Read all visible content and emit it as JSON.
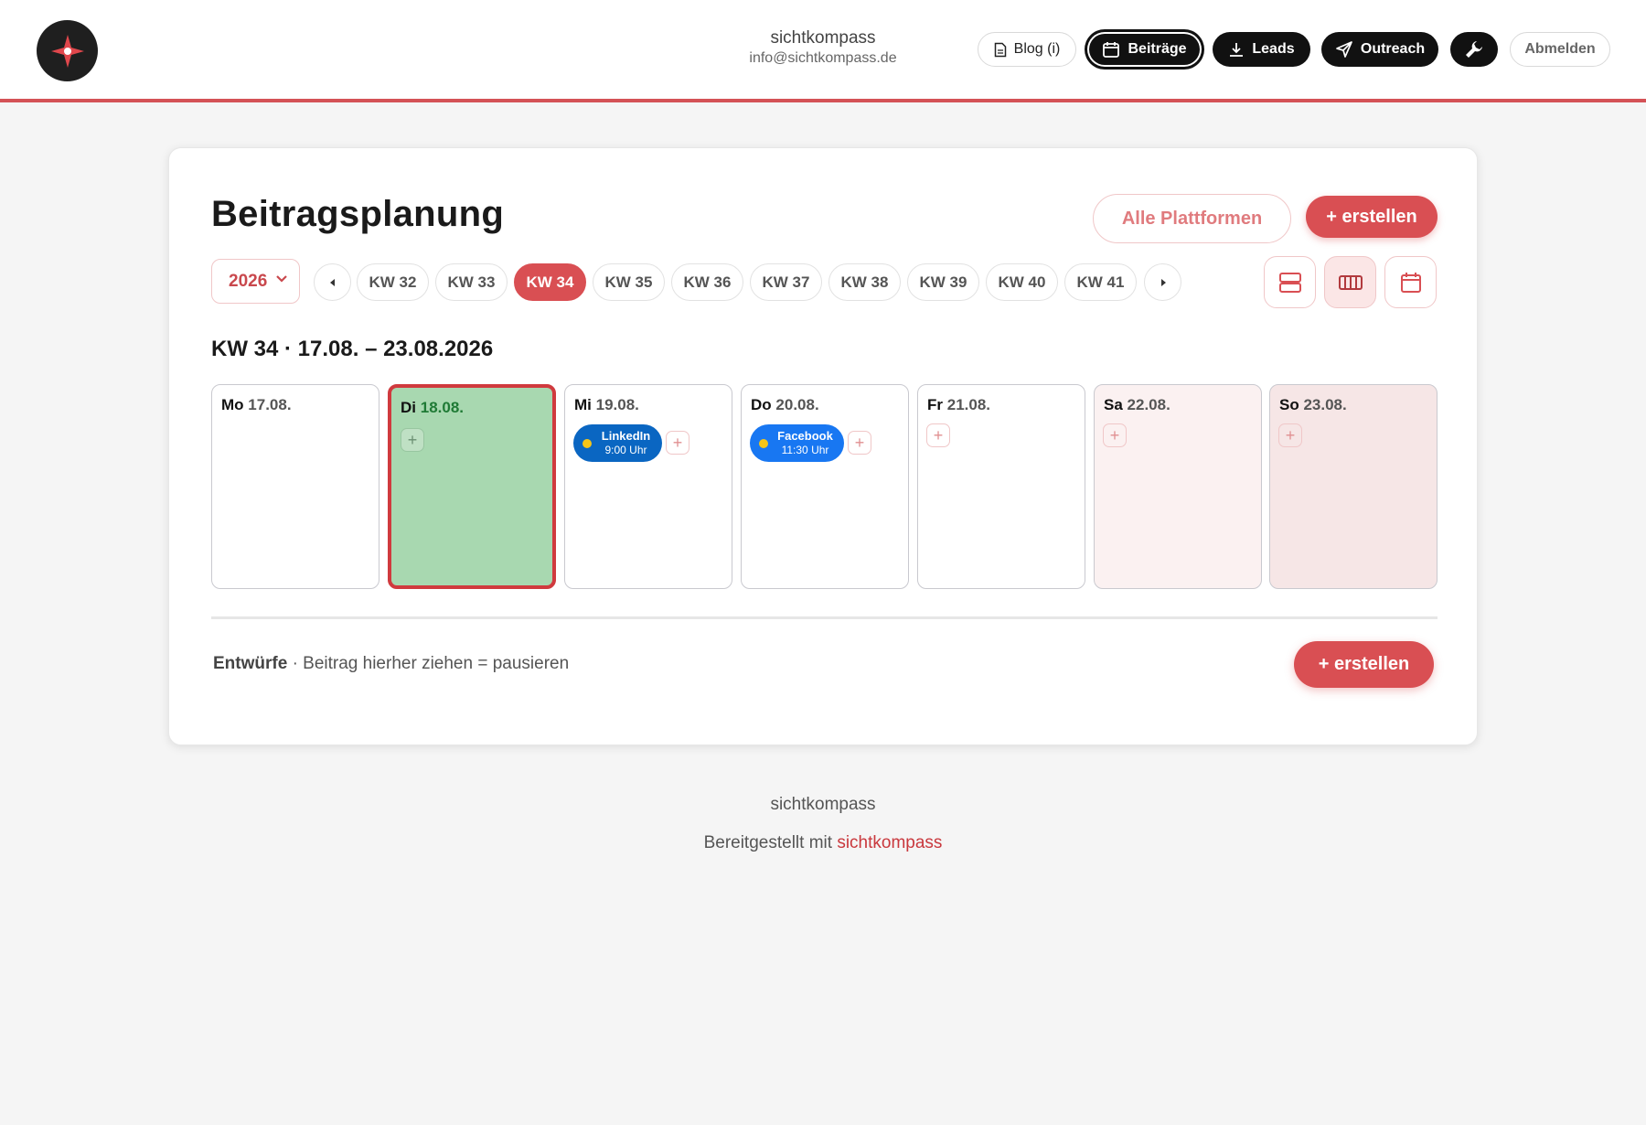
{
  "header": {
    "user_name": "sichtkompass",
    "user_email": "info@sichtkompass.de",
    "nav": {
      "blog": "Blog (i)",
      "posts": "Beiträge",
      "leads": "Leads",
      "outreach": "Outreach",
      "logout": "Abmelden"
    }
  },
  "planner": {
    "title": "Beitragsplanung",
    "platform_filter": "Alle Plattformen",
    "create_label": "+ erstellen",
    "year": "2026",
    "weeks": [
      "KW 32",
      "KW 33",
      "KW 34",
      "KW 35",
      "KW 36",
      "KW 37",
      "KW 38",
      "KW 39",
      "KW 40",
      "KW 41"
    ],
    "selected_week": "KW 34",
    "week_label": "KW 34 · 17.08. – 23.08.2026",
    "days": [
      {
        "weekday": "Mo",
        "date": "17.08."
      },
      {
        "weekday": "Di",
        "date": "18.08."
      },
      {
        "weekday": "Mi",
        "date": "19.08."
      },
      {
        "weekday": "Do",
        "date": "20.08."
      },
      {
        "weekday": "Fr",
        "date": "21.08."
      },
      {
        "weekday": "Sa",
        "date": "22.08."
      },
      {
        "weekday": "So",
        "date": "23.08."
      }
    ],
    "posts": [
      {
        "platform": "LinkedIn",
        "time": "9:00 Uhr",
        "color": "#0a66c2"
      },
      {
        "platform": "Facebook",
        "time": "11:30 Uhr",
        "color": "#1877f2"
      }
    ],
    "add_symbol": "+",
    "drafts": {
      "title": "Entwürfe",
      "hint": "· Beitrag hierher ziehen = pausieren",
      "create_label": "+ erstellen"
    }
  },
  "footer": {
    "brand": "sichtkompass",
    "provided_by": "Bereitgestellt mit",
    "link": "sichtkompass"
  },
  "colors": {
    "accent": "#d94f53",
    "today_bg": "#a8d8b0",
    "today_border": "#d03a3e"
  }
}
